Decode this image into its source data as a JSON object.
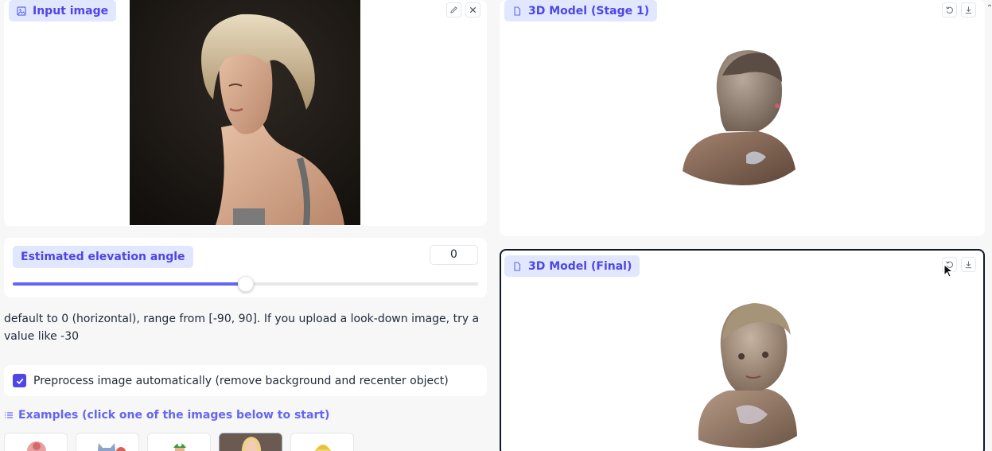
{
  "input_panel": {
    "label": "Input image",
    "icons": {
      "label_icon": "image-icon",
      "edit": "pencil-icon",
      "clear": "close-icon"
    }
  },
  "elevation": {
    "label": "Estimated elevation angle",
    "value": "0",
    "slider_min": -90,
    "slider_max": 90,
    "slider_value": 0
  },
  "info_text": "default to 0 (horizontal), range from [-90, 90]. If you upload a look-down image, try a value like -30",
  "preprocess": {
    "label": "Preprocess image automatically (remove background and recenter object)",
    "checked": true
  },
  "examples": {
    "heading": "Examples (click one of the images below to start)",
    "icon": "list-icon",
    "thumbnails": [
      "pink-figure",
      "cat-figure",
      "green-cap-figure",
      "blonde-figure",
      "yellow-figure"
    ],
    "selected_index": 3
  },
  "stage1": {
    "label": "3D Model (Stage 1)",
    "icons": {
      "label_icon": "file-icon",
      "reset": "undo-icon",
      "download": "download-icon"
    }
  },
  "final": {
    "label": "3D Model (Final)",
    "icons": {
      "label_icon": "file-icon",
      "reset": "undo-icon",
      "download": "download-icon"
    }
  },
  "colors": {
    "accent": "#4f46e5",
    "chip_bg": "#e0e7ff",
    "panel_bg": "#ffffff",
    "page_bg": "#f7f7f8"
  }
}
